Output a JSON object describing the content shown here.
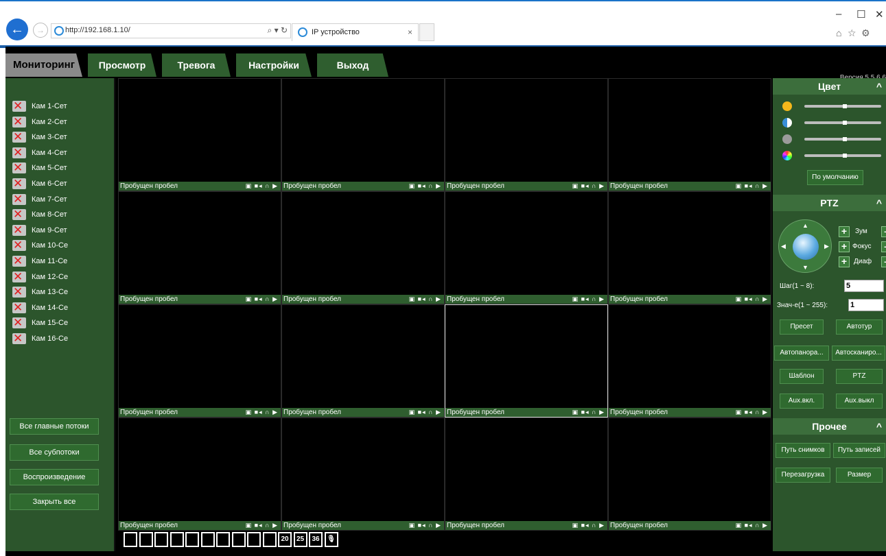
{
  "browser": {
    "url": "http://192.168.1.10/",
    "tab_title": "IP устройство",
    "addr_controls": "⌕ ▾ ↻",
    "tab_close": "×",
    "win_min": "–",
    "win_max": "☐",
    "win_close": "✕",
    "home_icon": "⌂",
    "star_icon": "☆",
    "gear_icon": "⚙"
  },
  "nav": {
    "tabs": [
      "Мониторинг",
      "Просмотр",
      "Тревога",
      "Настройки",
      "Выход"
    ],
    "active": 0
  },
  "version": "Версия 5.5.6.6",
  "cameras": [
    "Кам 1-Сет",
    "Кам 2-Сет",
    "Кам 3-Сет",
    "Кам 4-Сет",
    "Кам 5-Сет",
    "Кам 6-Сет",
    "Кам 7-Сет",
    "Кам 8-Сет",
    "Кам 9-Сет",
    "Кам 10-Се",
    "Кам 11-Се",
    "Кам 12-Се",
    "Кам 13-Се",
    "Кам 14-Се",
    "Кам 15-Се",
    "Кам 16-Се"
  ],
  "left_buttons": {
    "all_main": "Все главные потоки",
    "all_sub": "Все субпотоки",
    "playback": "Воспроизведение",
    "close_all": "Закрыть все"
  },
  "cell_status": "Пробущен пробел",
  "cell_icons": "▣ ■◂ ∩ ▶",
  "layouts": [
    "",
    "",
    "",
    "",
    "",
    "",
    "",
    "",
    "",
    "",
    "20",
    "25",
    "36",
    "🎙"
  ],
  "color_panel": {
    "title": "Цвет",
    "chevron": "^",
    "levels": [
      0.5,
      0.5,
      0.5,
      0.5
    ],
    "default_button": "По умолчанию"
  },
  "ptz_panel": {
    "title": "PTZ",
    "chevron": "^",
    "arrows": {
      "up": "▲",
      "down": "▼",
      "left": "◀",
      "right": "▶"
    },
    "plus": "+",
    "minus": "–",
    "zoom": "Зум",
    "focus": "Фокус",
    "iris": "Диаф",
    "step_label": "Шаг(1 ~ 8):",
    "step_value": "5",
    "value_label": "Знач-е(1 ~ 255):",
    "value_value": "1",
    "preset": "Пресет",
    "autotour": "Автотур",
    "autopan": "Автопанора...",
    "autoscan": "Автосканиро...",
    "pattern": "Шаблон",
    "ptz": "PTZ",
    "aux_on": "Aux.вкл.",
    "aux_off": "Aux.выкл"
  },
  "misc_panel": {
    "title": "Прочее",
    "chevron": "^",
    "snap_path": "Путь снимков",
    "rec_path": "Путь записей",
    "reboot": "Перезагрузка",
    "size": "Размер"
  }
}
